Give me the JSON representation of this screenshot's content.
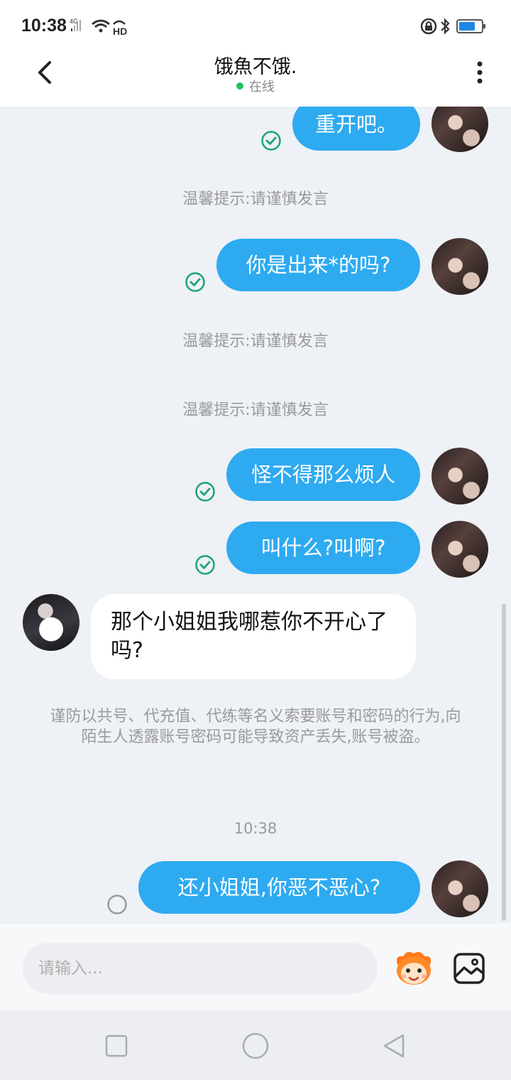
{
  "status_bar": {
    "time": "10:38",
    "network_label": "4G",
    "hd_label": "HD"
  },
  "header": {
    "back_icon": "chevron-left-icon",
    "title": "饿魚不饿.",
    "status": "在线",
    "status_color": "#22c35e",
    "more_icon": "more-vertical-icon"
  },
  "messages": [
    {
      "type": "outgoing",
      "text": "重开吧。",
      "status": "delivered"
    },
    {
      "type": "hint",
      "text": "温馨提示:请谨慎发言"
    },
    {
      "type": "outgoing",
      "text": "你是出来*的吗?",
      "status": "delivered"
    },
    {
      "type": "hint",
      "text": "温馨提示:请谨慎发言"
    },
    {
      "type": "hint",
      "text": "温馨提示:请谨慎发言"
    },
    {
      "type": "outgoing",
      "text": "怪不得那么烦人",
      "status": "delivered"
    },
    {
      "type": "outgoing",
      "text": "叫什么?叫啊?",
      "status": "delivered"
    },
    {
      "type": "incoming",
      "text": "那个小姐姐我哪惹你不开心了吗?"
    },
    {
      "type": "warning",
      "text": "谨防以共号、代充值、代练等名义索要账号和密码的行为,向陌生人透露账号密码可能导致资产丢失,账号被盗。"
    },
    {
      "type": "timestamp",
      "text": "10:38"
    },
    {
      "type": "outgoing",
      "text": "还小姐姐,你恶不恶心?",
      "status": "sending"
    }
  ],
  "input": {
    "placeholder": "请输入...",
    "value": ""
  },
  "toolbar": {
    "emoji_icon": "emoji-mascot-icon",
    "image_icon": "image-icon"
  },
  "nav": {
    "recent_icon": "square-icon",
    "home_icon": "circle-icon",
    "back_icon": "triangle-back-icon"
  },
  "colors": {
    "accent": "#2eaaf0",
    "check": "#1aa37a",
    "background": "#eef1f5"
  }
}
